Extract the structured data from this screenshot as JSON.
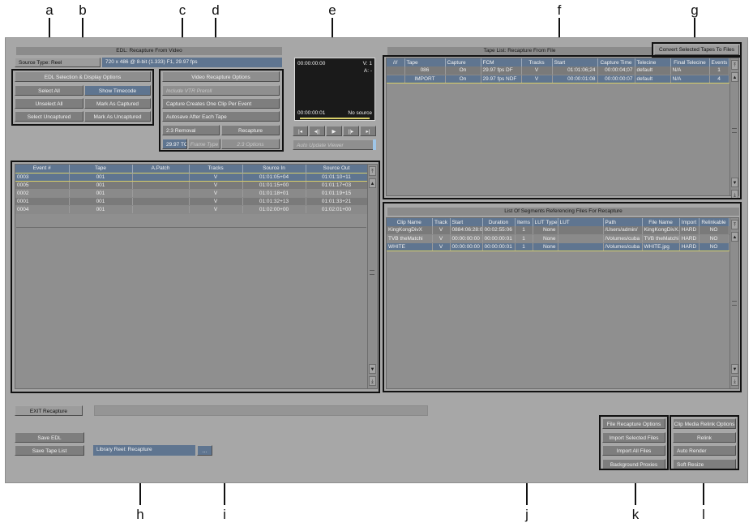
{
  "callouts": [
    "a",
    "b",
    "c",
    "d",
    "e",
    "f",
    "g",
    "h",
    "i",
    "j",
    "k",
    "l"
  ],
  "edl": {
    "title": "EDL: Recapture From Video",
    "source_type_label": "Source Type: Reel",
    "format": "720 x 486 @ 8-bit (1.333) F1, 29.97 fps"
  },
  "selection": {
    "header": "EDL Selection & Display Options",
    "select_all": "Select All",
    "show_timecode": "Show Timecode",
    "unselect_all": "Unselect All",
    "mark_captured": "Mark As Captured",
    "select_uncaptured": "Select Uncaptured",
    "mark_uncaptured": "Mark As Uncaptured"
  },
  "video_opts": {
    "header": "Video Recapture Options",
    "include_vtr": "Include VTR Preroll",
    "one_clip": "Capture Creates One Clip Per Event",
    "autosave": "Autosave After Each Tape",
    "removal": "2:3 Removal",
    "recapture": "Recapture",
    "tc": "29.97 TC",
    "frame_type": "Frame Type",
    "options_23": "2:3 Options"
  },
  "viewer": {
    "tc_top": "00:00:00:00",
    "v_track": "V: 1",
    "a_track": "A: -",
    "tc_bottom": "00:00:00:01",
    "no_source": "No source",
    "auto_update": "Auto Update Viewer",
    "transport": [
      "|◂",
      "◂||",
      "▶",
      "||▸",
      "▸|"
    ]
  },
  "events": {
    "columns": [
      "Event #",
      "Tape",
      "A.Patch",
      "Tracks",
      "Source In",
      "Source Out"
    ],
    "rows": [
      [
        "0003",
        "001",
        "",
        "V",
        "01:01:05+04",
        "01:01:10+11"
      ],
      [
        "0005",
        "001",
        "",
        "V",
        "01:01:15+00",
        "01:01:17+03"
      ],
      [
        "0002",
        "001",
        "",
        "V",
        "01:01:18+01",
        "01:01:19+15"
      ],
      [
        "0001",
        "001",
        "",
        "V",
        "01:01:32+13",
        "01:01:33+21"
      ],
      [
        "0004",
        "001",
        "",
        "V",
        "01:02:00+00",
        "01:02:01+00"
      ]
    ]
  },
  "tapelist": {
    "title": "Tape List: Recapture From File",
    "convert": "Convert Selected Tapes To Files",
    "corner": "///",
    "columns": [
      "Tape",
      "Capture",
      "FCM",
      "Tracks",
      "Start",
      "Capture Time",
      "Telecine",
      "Final Telecine",
      "Events"
    ],
    "rows": [
      [
        "086",
        "On",
        "29.97 fps DF",
        "V",
        "01:01:06;24",
        "00:00:04;07",
        "default",
        "N/A",
        "1"
      ],
      [
        "IMPORT",
        "On",
        "29.97 fps NDF",
        "V",
        "00:00:01:08",
        "00:00:00:07",
        "default",
        "N/A",
        "4"
      ]
    ]
  },
  "segments": {
    "title": "List Of Segments Referencing Files For Recapture",
    "columns": [
      "Clip Name",
      "Track",
      "Start",
      "Duration",
      "Items",
      "LUT Type",
      "LUT",
      "Path",
      "File Name",
      "Import",
      "Relinkable"
    ],
    "rows": [
      [
        "KingKongDivX",
        "V",
        "0884:06:28:0",
        "00:02:55:06",
        "1",
        "None",
        "",
        "/Users/admin/",
        "KingKongDivX.",
        "HARD",
        "NO"
      ],
      [
        "TVB theMatchi",
        "V",
        "00:00:00:00",
        "00:00:00:01",
        "1",
        "None",
        "",
        "/Volumes/cuba",
        "TVB theMatchi",
        "HARD",
        "NO"
      ],
      [
        "WHITE",
        "V",
        "00:00:00:00",
        "00:00:00:01",
        "1",
        "None",
        "",
        "/Volumes/cuba",
        "WHITE.jpg",
        "HARD",
        "NO"
      ]
    ]
  },
  "bottom": {
    "exit": "EXIT Recapture",
    "save_edl": "Save EDL",
    "save_tape_list": "Save Tape List",
    "library_reel": "Library Reel: Recapture",
    "ellipsis": "..."
  },
  "file_opts": {
    "header": "File Recapture Options",
    "import_selected": "Import Selected Files",
    "import_all": "Import All Files",
    "background_proxies": "Background Proxies"
  },
  "relink": {
    "header": "Clip Media Relink Options",
    "relink": "Relink",
    "auto_render": "Auto Render",
    "soft_resize": "Soft Resize"
  }
}
